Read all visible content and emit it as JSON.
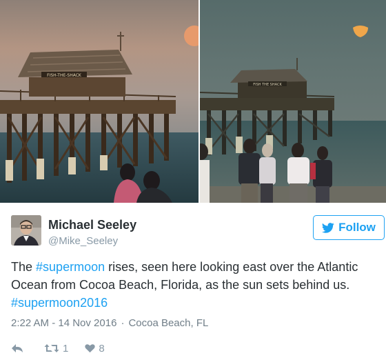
{
  "media": {
    "left_sign": "FISH-THE-SHACK",
    "right_sign": "FISH THE SHACK"
  },
  "user": {
    "name": "Michael Seeley",
    "handle": "@Mike_Seeley"
  },
  "follow_button": {
    "label": "Follow"
  },
  "tweet": {
    "parts": [
      "The ",
      "#supermoon",
      " rises, seen here looking east over the Atlantic Ocean from Cocoa Beach, Florida, as the sun sets behind us. ",
      "#supermoon2016"
    ],
    "time": "2:22 AM - 14 Nov 2016",
    "separator": "·",
    "location": "Cocoa Beach, FL"
  },
  "actions": {
    "reply_icon": "reply-icon",
    "retweet_icon": "retweet-icon",
    "like_icon": "heart-icon",
    "retweet_count": "1",
    "like_count": "8"
  },
  "colors": {
    "accent": "#1da1f2",
    "text": "#292f33",
    "muted": "#8899a6"
  }
}
